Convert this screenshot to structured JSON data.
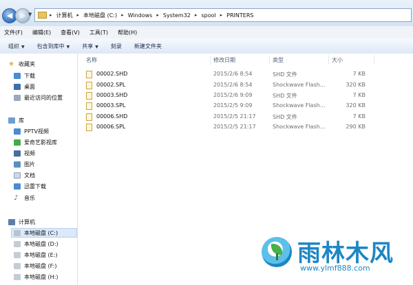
{
  "address": {
    "crumbs": [
      "计算机",
      "本地磁盘 (C:)",
      "Windows",
      "System32",
      "spool",
      "PRINTERS"
    ]
  },
  "menu": [
    "文件(F)",
    "编辑(E)",
    "查看(V)",
    "工具(T)",
    "帮助(H)"
  ],
  "toolbar": {
    "organize": "组织",
    "include_library": "包含到库中",
    "share": "共享",
    "burn": "刻录",
    "new_folder": "新建文件夹"
  },
  "sidebar": {
    "favorites_header": "收藏夹",
    "favorites": [
      "下载",
      "桌面",
      "最近访问的位置"
    ],
    "libraries_header": "库",
    "libraries": [
      "PPTV视频",
      "爱奇艺影视库",
      "视频",
      "图片",
      "文档",
      "迅雷下载",
      "音乐"
    ],
    "computer_header": "计算机",
    "drives": [
      "本地磁盘 (C:)",
      "本地磁盘 (D:)",
      "本地磁盘 (E:)",
      "本地磁盘 (F:)",
      "本地磁盘 (H:)"
    ]
  },
  "columns": {
    "name": "名称",
    "date": "修改日期",
    "type": "类型",
    "size": "大小"
  },
  "files": [
    {
      "name": "00002.SHD",
      "date": "2015/2/6 8:54",
      "type": "SHD 文件",
      "size": "7 KB"
    },
    {
      "name": "00002.SPL",
      "date": "2015/2/6 8:54",
      "type": "Shockwave Flash...",
      "size": "320 KB"
    },
    {
      "name": "00003.SHD",
      "date": "2015/2/6 9:09",
      "type": "SHD 文件",
      "size": "7 KB"
    },
    {
      "name": "00003.SPL",
      "date": "2015/2/5 9:09",
      "type": "Shockwave Flash...",
      "size": "320 KB"
    },
    {
      "name": "00006.SHD",
      "date": "2015/2/5 21:17",
      "type": "SHD 文件",
      "size": "7 KB"
    },
    {
      "name": "00006.SPL",
      "date": "2015/2/5 21:17",
      "type": "Shockwave Flash...",
      "size": "290 KB"
    }
  ],
  "watermark": {
    "title": "雨林木风",
    "url": "www.ylmf888.com"
  },
  "icons": {
    "back": "back-arrow-icon",
    "forward": "forward-arrow-icon",
    "favorites": "star-icon",
    "library": "library-icon",
    "computer": "computer-icon",
    "drive": "drive-icon",
    "file": "file-icon"
  }
}
